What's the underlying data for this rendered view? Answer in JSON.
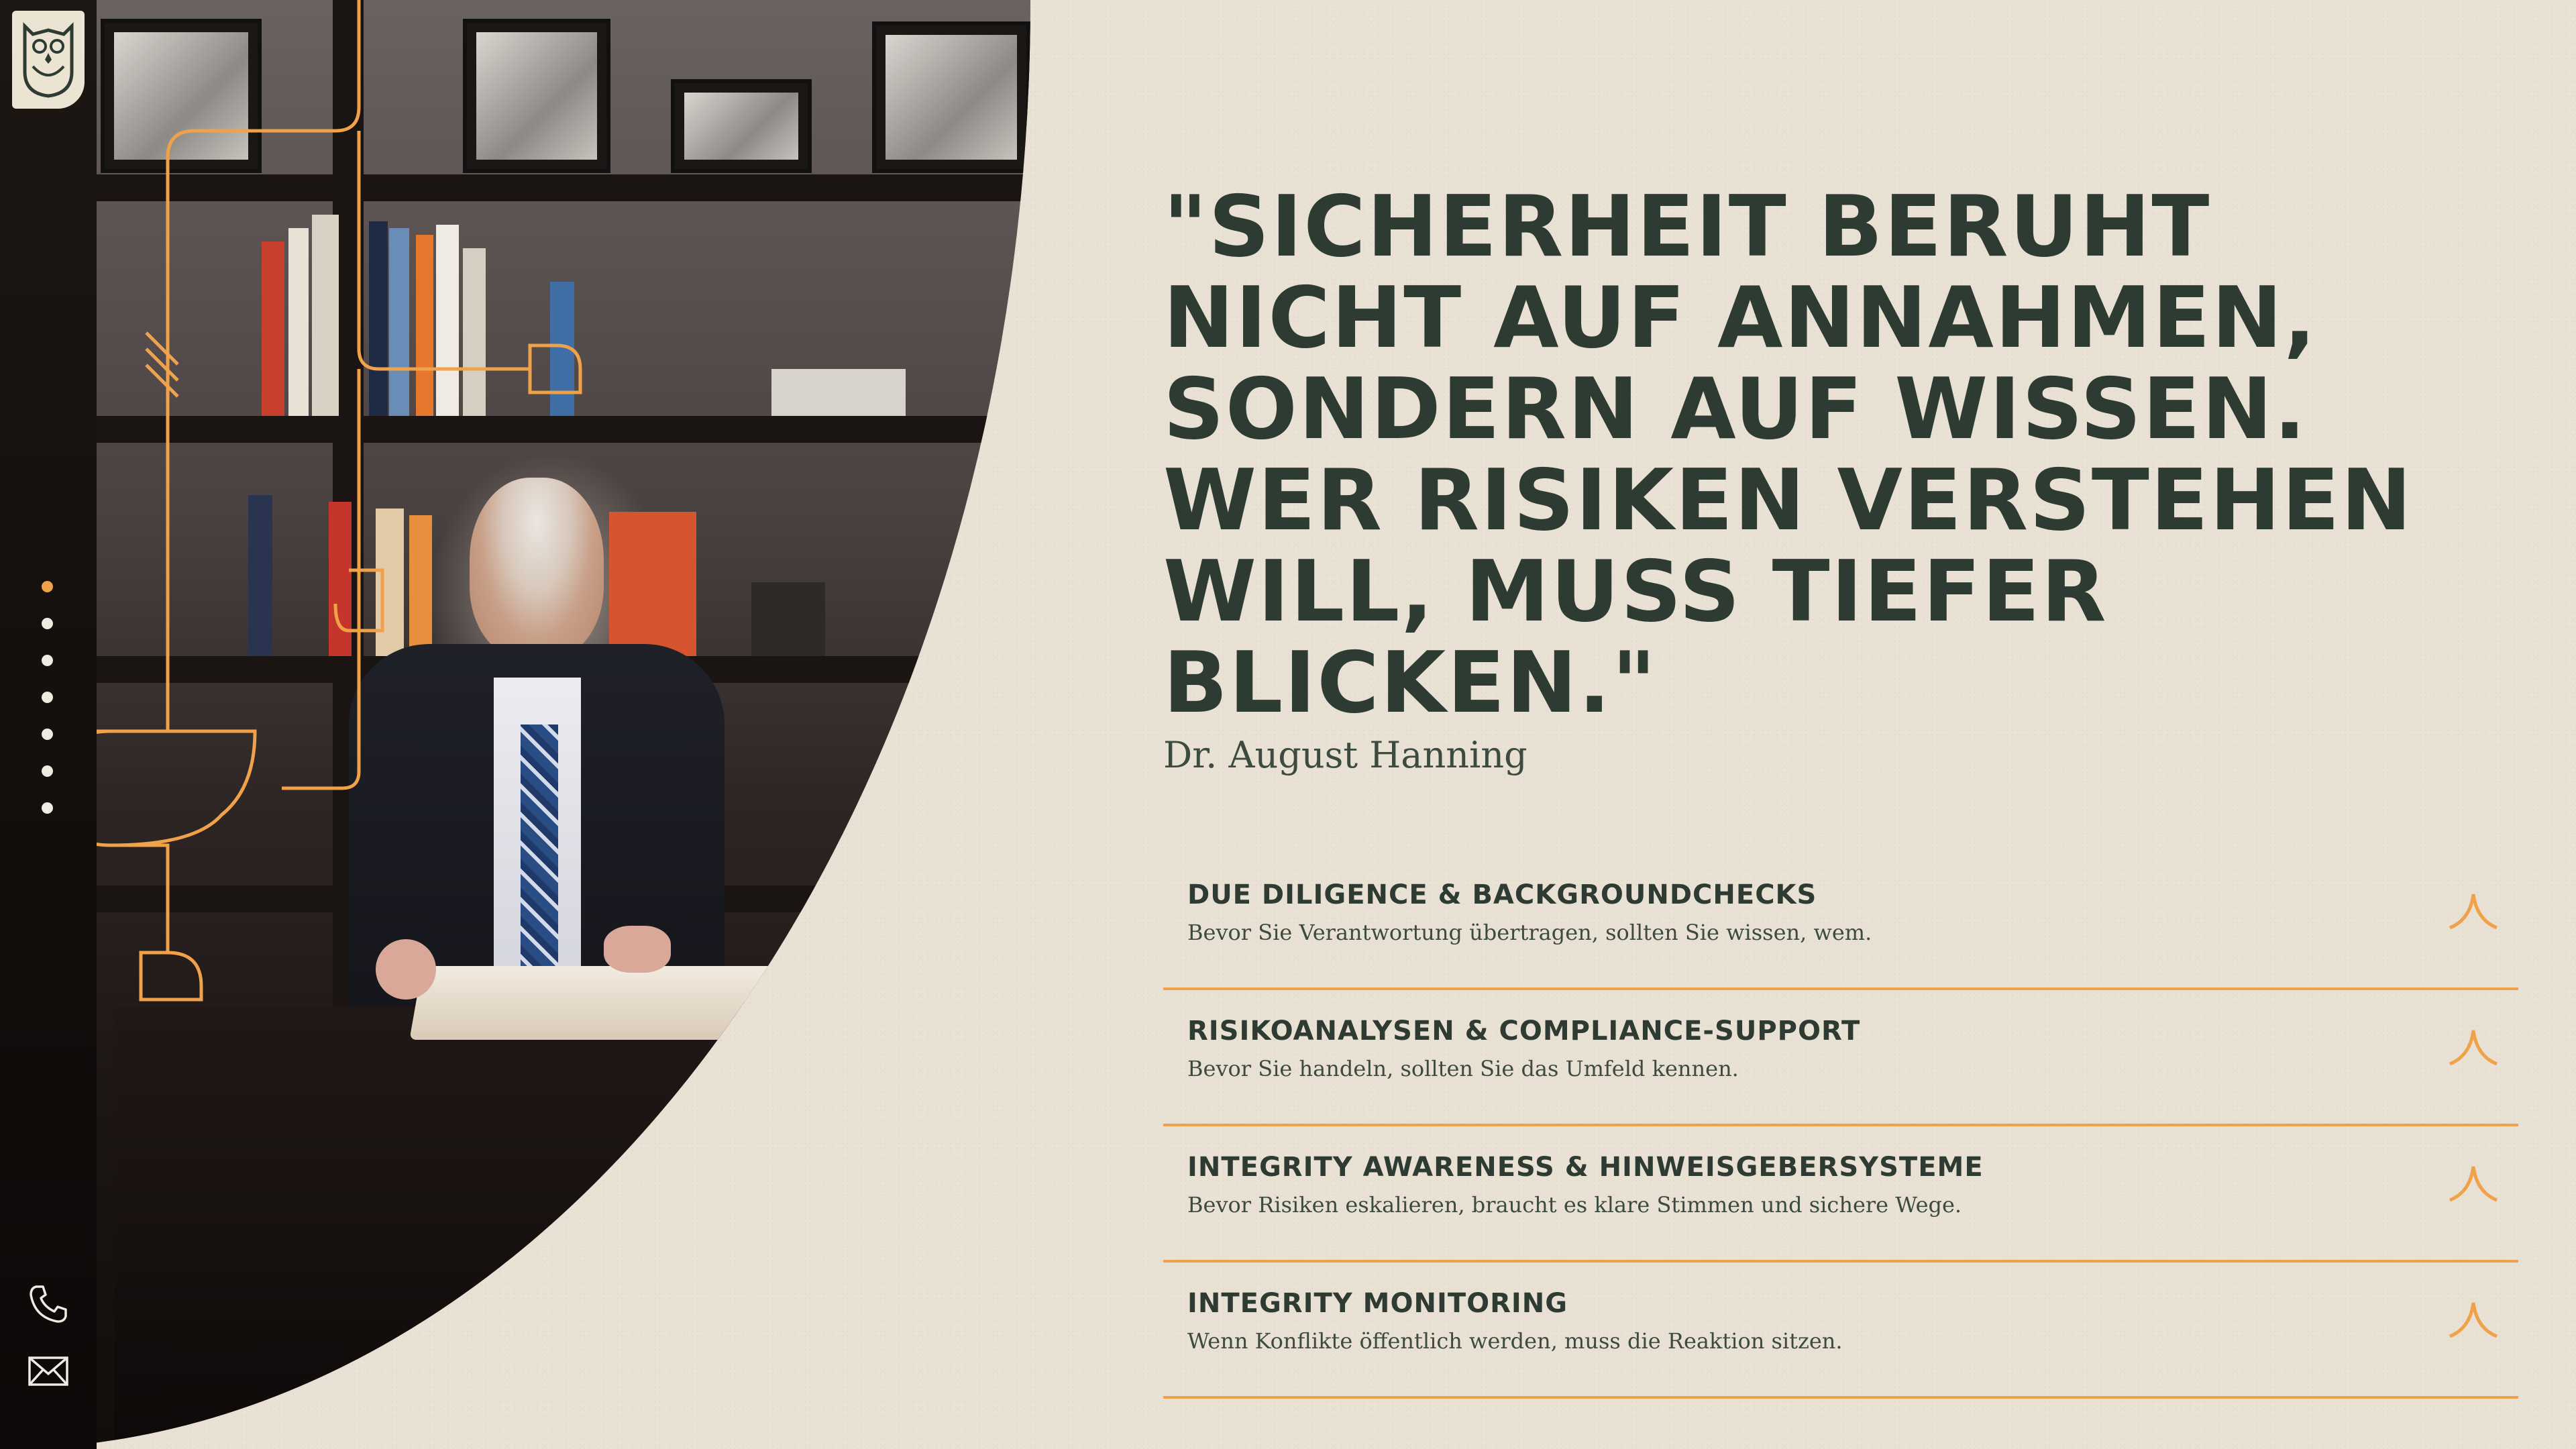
{
  "brand": {
    "logo_icon": "owl-logo-icon",
    "accent_color": "#f0a24b",
    "text_color": "#2e3b32"
  },
  "nav": {
    "slides": 7,
    "active_index": 0
  },
  "contact": {
    "phone_icon": "phone-icon",
    "mail_icon": "mail-icon"
  },
  "quote": {
    "text": "\"SICHERHEIT BERUHT NICHT AUF ANNAHMEN, SONDERN AUF WISSEN. WER RISIKEN VERSTEHEN WILL, MUSS TIEFER BLICKEN.\"",
    "author": "Dr. August Hanning"
  },
  "services": [
    {
      "title": "DUE DILIGENCE & BACKGROUNDCHECKS",
      "desc": "Bevor Sie Verantwortung übertragen, sollten Sie wissen, wem."
    },
    {
      "title": "RISIKOANALYSEN & COMPLIANCE-SUPPORT",
      "desc": "Bevor Sie handeln, sollten Sie das Umfeld kennen."
    },
    {
      "title": "INTEGRITY AWARENESS & HINWEISGEBERSYSTEME",
      "desc": "Bevor Risiken eskalieren, braucht es klare Stimmen und sichere Wege."
    },
    {
      "title": "INTEGRITY MONITORING",
      "desc": "Wenn Konflikte öffentlich werden, muss die Reaktion sitzen."
    }
  ]
}
